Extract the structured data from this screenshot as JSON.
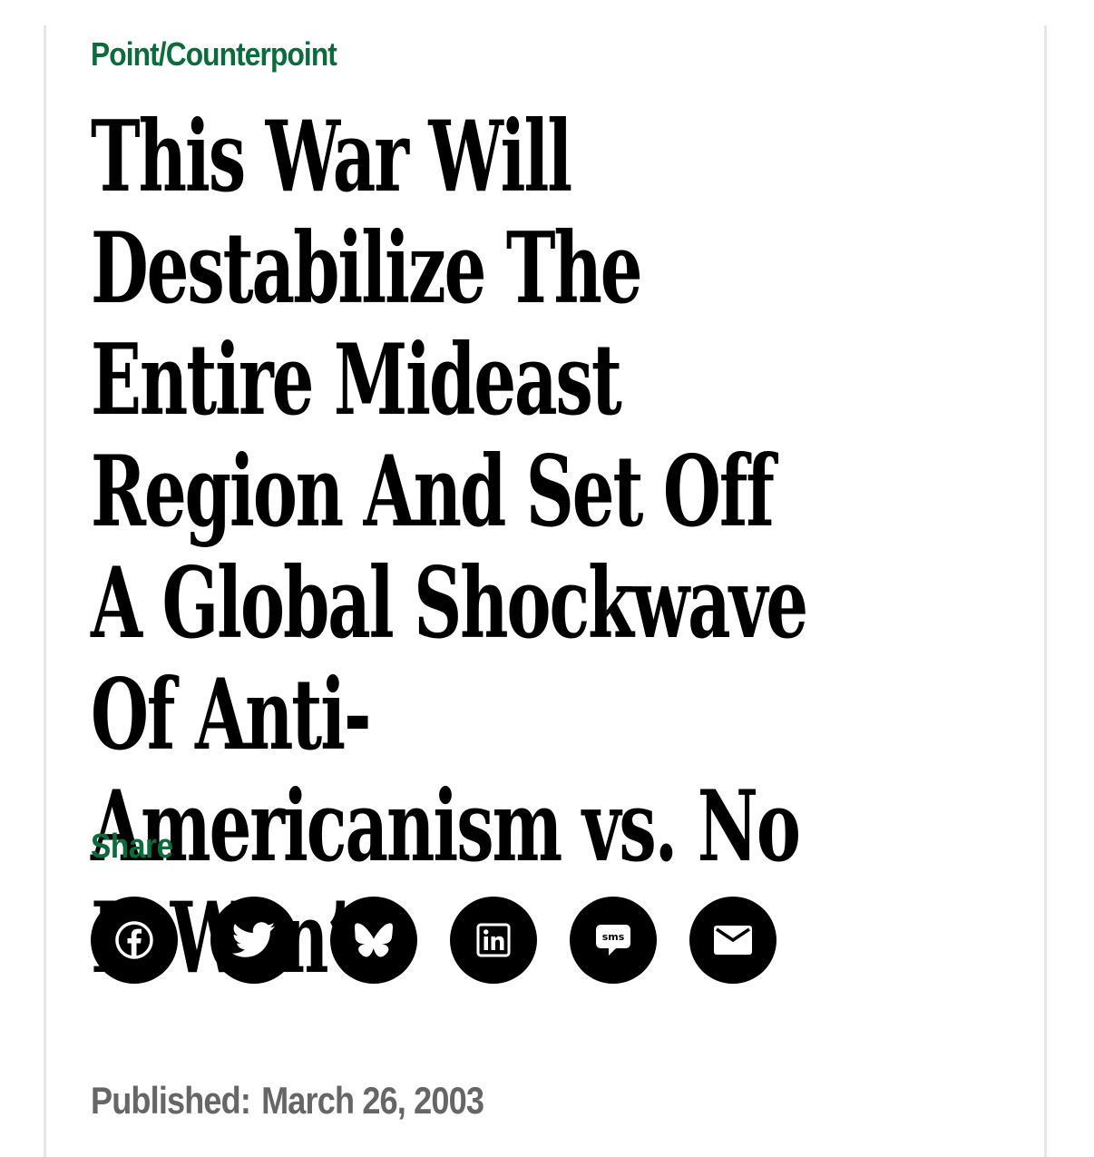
{
  "article": {
    "kicker": "Point/Counterpoint",
    "headline": "This War Will Destabilize The Entire Mideast Region And Set Off A Global Shockwave Of Anti-Americanism vs. No It Won’t",
    "share_label": "Share",
    "share_buttons": [
      {
        "icon": "facebook-icon"
      },
      {
        "icon": "twitter-icon"
      },
      {
        "icon": "bluesky-icon"
      },
      {
        "icon": "linkedin-icon"
      },
      {
        "icon": "sms-icon",
        "text": "sms"
      },
      {
        "icon": "email-icon"
      }
    ],
    "published_label": "Published:",
    "published_date": "March 26, 2003"
  },
  "colors": {
    "accent_green": "#0a6b3b",
    "headline": "#000000",
    "meta_gray": "#666666",
    "icon_bg": "#000000"
  }
}
